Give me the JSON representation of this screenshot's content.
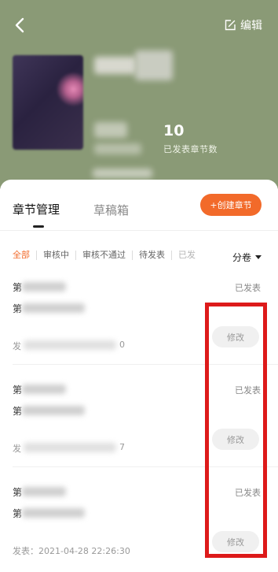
{
  "header": {
    "edit_label": "编辑",
    "chapter_count": "10",
    "chapter_count_label": "已发表章节数",
    "background_color": "#8a9a76"
  },
  "tabs": {
    "manage": "章节管理",
    "drafts": "草稿箱"
  },
  "create_button": "+创建章节",
  "filters": {
    "items": [
      "全部",
      "审核中",
      "审核不通过",
      "待发表",
      "已发"
    ],
    "volume_label": "分卷"
  },
  "chapters": [
    {
      "line1": "第",
      "line2": "第",
      "published_prefix": "发",
      "published_suffix": "0",
      "status": "已发表",
      "modify_label": "修改"
    },
    {
      "line1": "第",
      "line2": "第",
      "published_prefix": "发",
      "published_suffix": "7",
      "status": "已发表",
      "modify_label": "修改"
    },
    {
      "line1": "第",
      "line2": "第",
      "published_full": "发表：2021-04-28 22:26:30",
      "status": "已发表",
      "modify_label": "修改"
    }
  ],
  "colors": {
    "accent": "#f26a2a",
    "highlight": "#dd1a1a"
  },
  "icons": {
    "back": "chevron-left-icon",
    "edit": "edit-icon",
    "volume_dropdown": "caret-down-icon"
  }
}
